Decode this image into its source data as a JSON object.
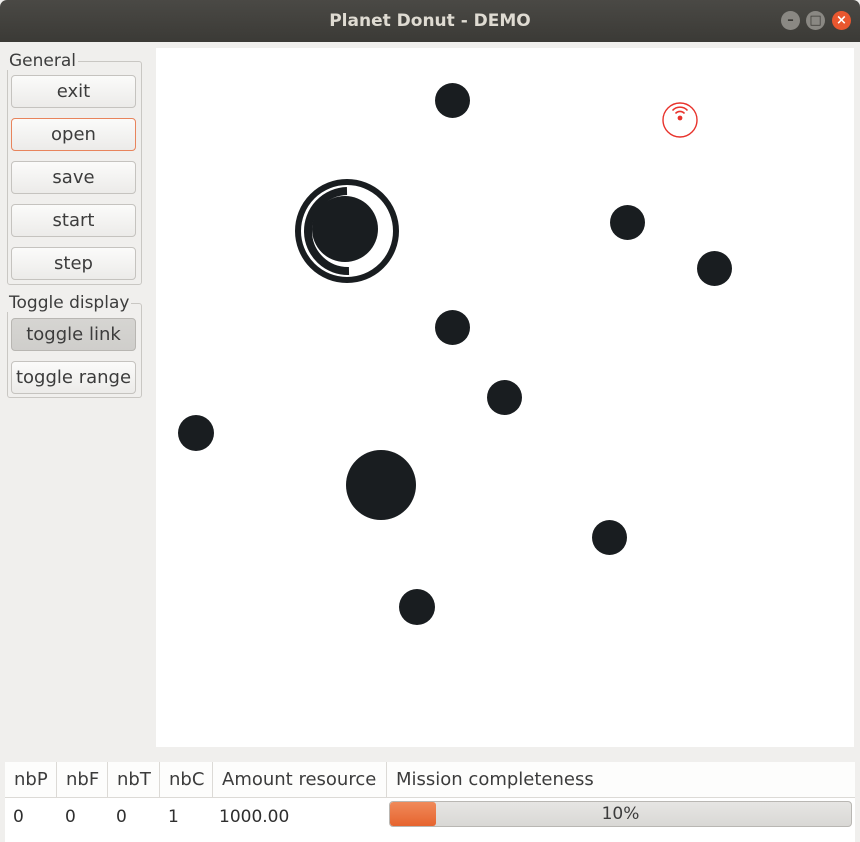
{
  "window": {
    "title": "Planet Donut - DEMO",
    "controls": [
      "minimize-icon",
      "maximize-icon",
      "close-icon"
    ]
  },
  "sidebar": {
    "general": {
      "legend": "General",
      "buttons": [
        {
          "label": "exit"
        },
        {
          "label": "open",
          "state": "focused"
        },
        {
          "label": "save"
        },
        {
          "label": "start"
        },
        {
          "label": "step"
        }
      ]
    },
    "toggle_display": {
      "legend": "Toggle display",
      "buttons": [
        {
          "label": "toggle link",
          "state": "pressed"
        },
        {
          "label": "toggle range"
        }
      ]
    }
  },
  "map": {
    "planet_color": "#191d20",
    "base_marker_color": "#191d20",
    "robot_marker_color": "#e8332c",
    "icons": [
      "base-ring-icon",
      "wifi-robot-icon"
    ]
  },
  "stats_table": {
    "headers": [
      "nbP",
      "nbF",
      "nbT",
      "nbC",
      "Amount resource",
      "Mission completeness"
    ],
    "row": {
      "nbP": "0",
      "nbF": "0",
      "nbT": "0",
      "nbC": "1",
      "amount_resource": "1000.00",
      "mission_completeness": 0.1,
      "mission_completeness_label": "10%"
    },
    "progress_color": "#e8692f"
  }
}
